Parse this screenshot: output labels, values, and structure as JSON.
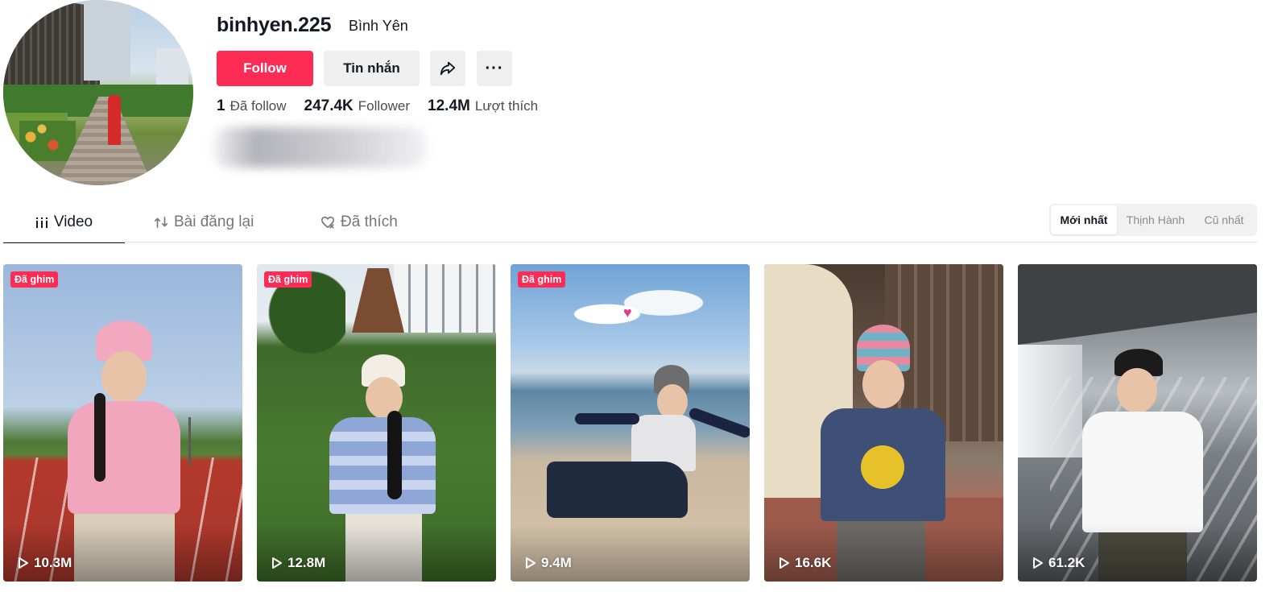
{
  "profile": {
    "username": "binhyen.225",
    "nickname": "Bình Yên",
    "buttons": {
      "follow": "Follow",
      "message": "Tin nhắn",
      "share_icon": "share-arrow-icon",
      "more_icon": "more-dots-icon",
      "more_label": "···"
    },
    "stats": [
      {
        "value": "1",
        "label": "Đã follow"
      },
      {
        "value": "247.4K",
        "label": "Follower"
      },
      {
        "value": "12.4M",
        "label": "Lượt thích"
      }
    ]
  },
  "tabs": [
    {
      "label": "Video",
      "icon": "grid-bars-icon",
      "active": true
    },
    {
      "label": "Bài đăng lại",
      "icon": "repost-icon",
      "active": false
    },
    {
      "label": "Đã thích",
      "icon": "liked-heart-icon",
      "active": false
    }
  ],
  "sort": {
    "options": [
      "Mới nhất",
      "Thịnh Hành",
      "Cũ nhất"
    ],
    "selected": "Mới nhất"
  },
  "videos": [
    {
      "pinned": true,
      "pin_label": "Đã ghim",
      "views": "10.3M"
    },
    {
      "pinned": true,
      "pin_label": "Đã ghim",
      "views": "12.8M"
    },
    {
      "pinned": true,
      "pin_label": "Đã ghim",
      "views": "9.4M"
    },
    {
      "pinned": false,
      "views": "16.6K"
    },
    {
      "pinned": false,
      "views": "61.2K"
    }
  ],
  "colors": {
    "accent": "#fe2c55",
    "text_primary": "#161823",
    "text_secondary": "#75767c",
    "button_secondary_bg": "#efefef"
  }
}
